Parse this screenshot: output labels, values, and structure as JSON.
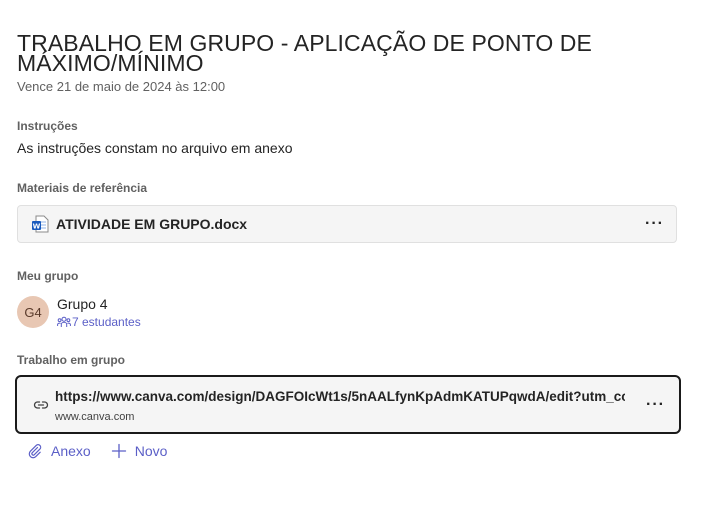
{
  "assignment": {
    "title": "TRABALHO EM GRUPO - APLICAÇÃO DE PONTO DE MÁXIMO/MÍNIMO",
    "due": "Vence 21 de maio de 2024 às 12:00"
  },
  "instructions": {
    "label": "Instruções",
    "text": "As instruções constam no arquivo em anexo"
  },
  "reference": {
    "label": "Materiais de referência",
    "file_name": "ATIVIDADE EM GRUPO.docx",
    "file_icon": "word-doc-icon",
    "more_label": "···"
  },
  "group": {
    "label": "Meu grupo",
    "avatar_initials": "G4",
    "name": "Grupo 4",
    "students": "7 estudantes",
    "avatar_color": "#e8c7b3"
  },
  "work": {
    "label": "Trabalho em grupo",
    "url": "https://www.canva.com/design/DAGFOIcWt1s/5nAALfynKpAdmKATUPqwdA/edit?utm_co",
    "domain": "www.canva.com",
    "more_label": "···"
  },
  "actions": {
    "attach_label": "Anexo",
    "new_label": "Novo"
  },
  "colors": {
    "accent": "#5b5fc7",
    "word_blue": "#185abd"
  }
}
